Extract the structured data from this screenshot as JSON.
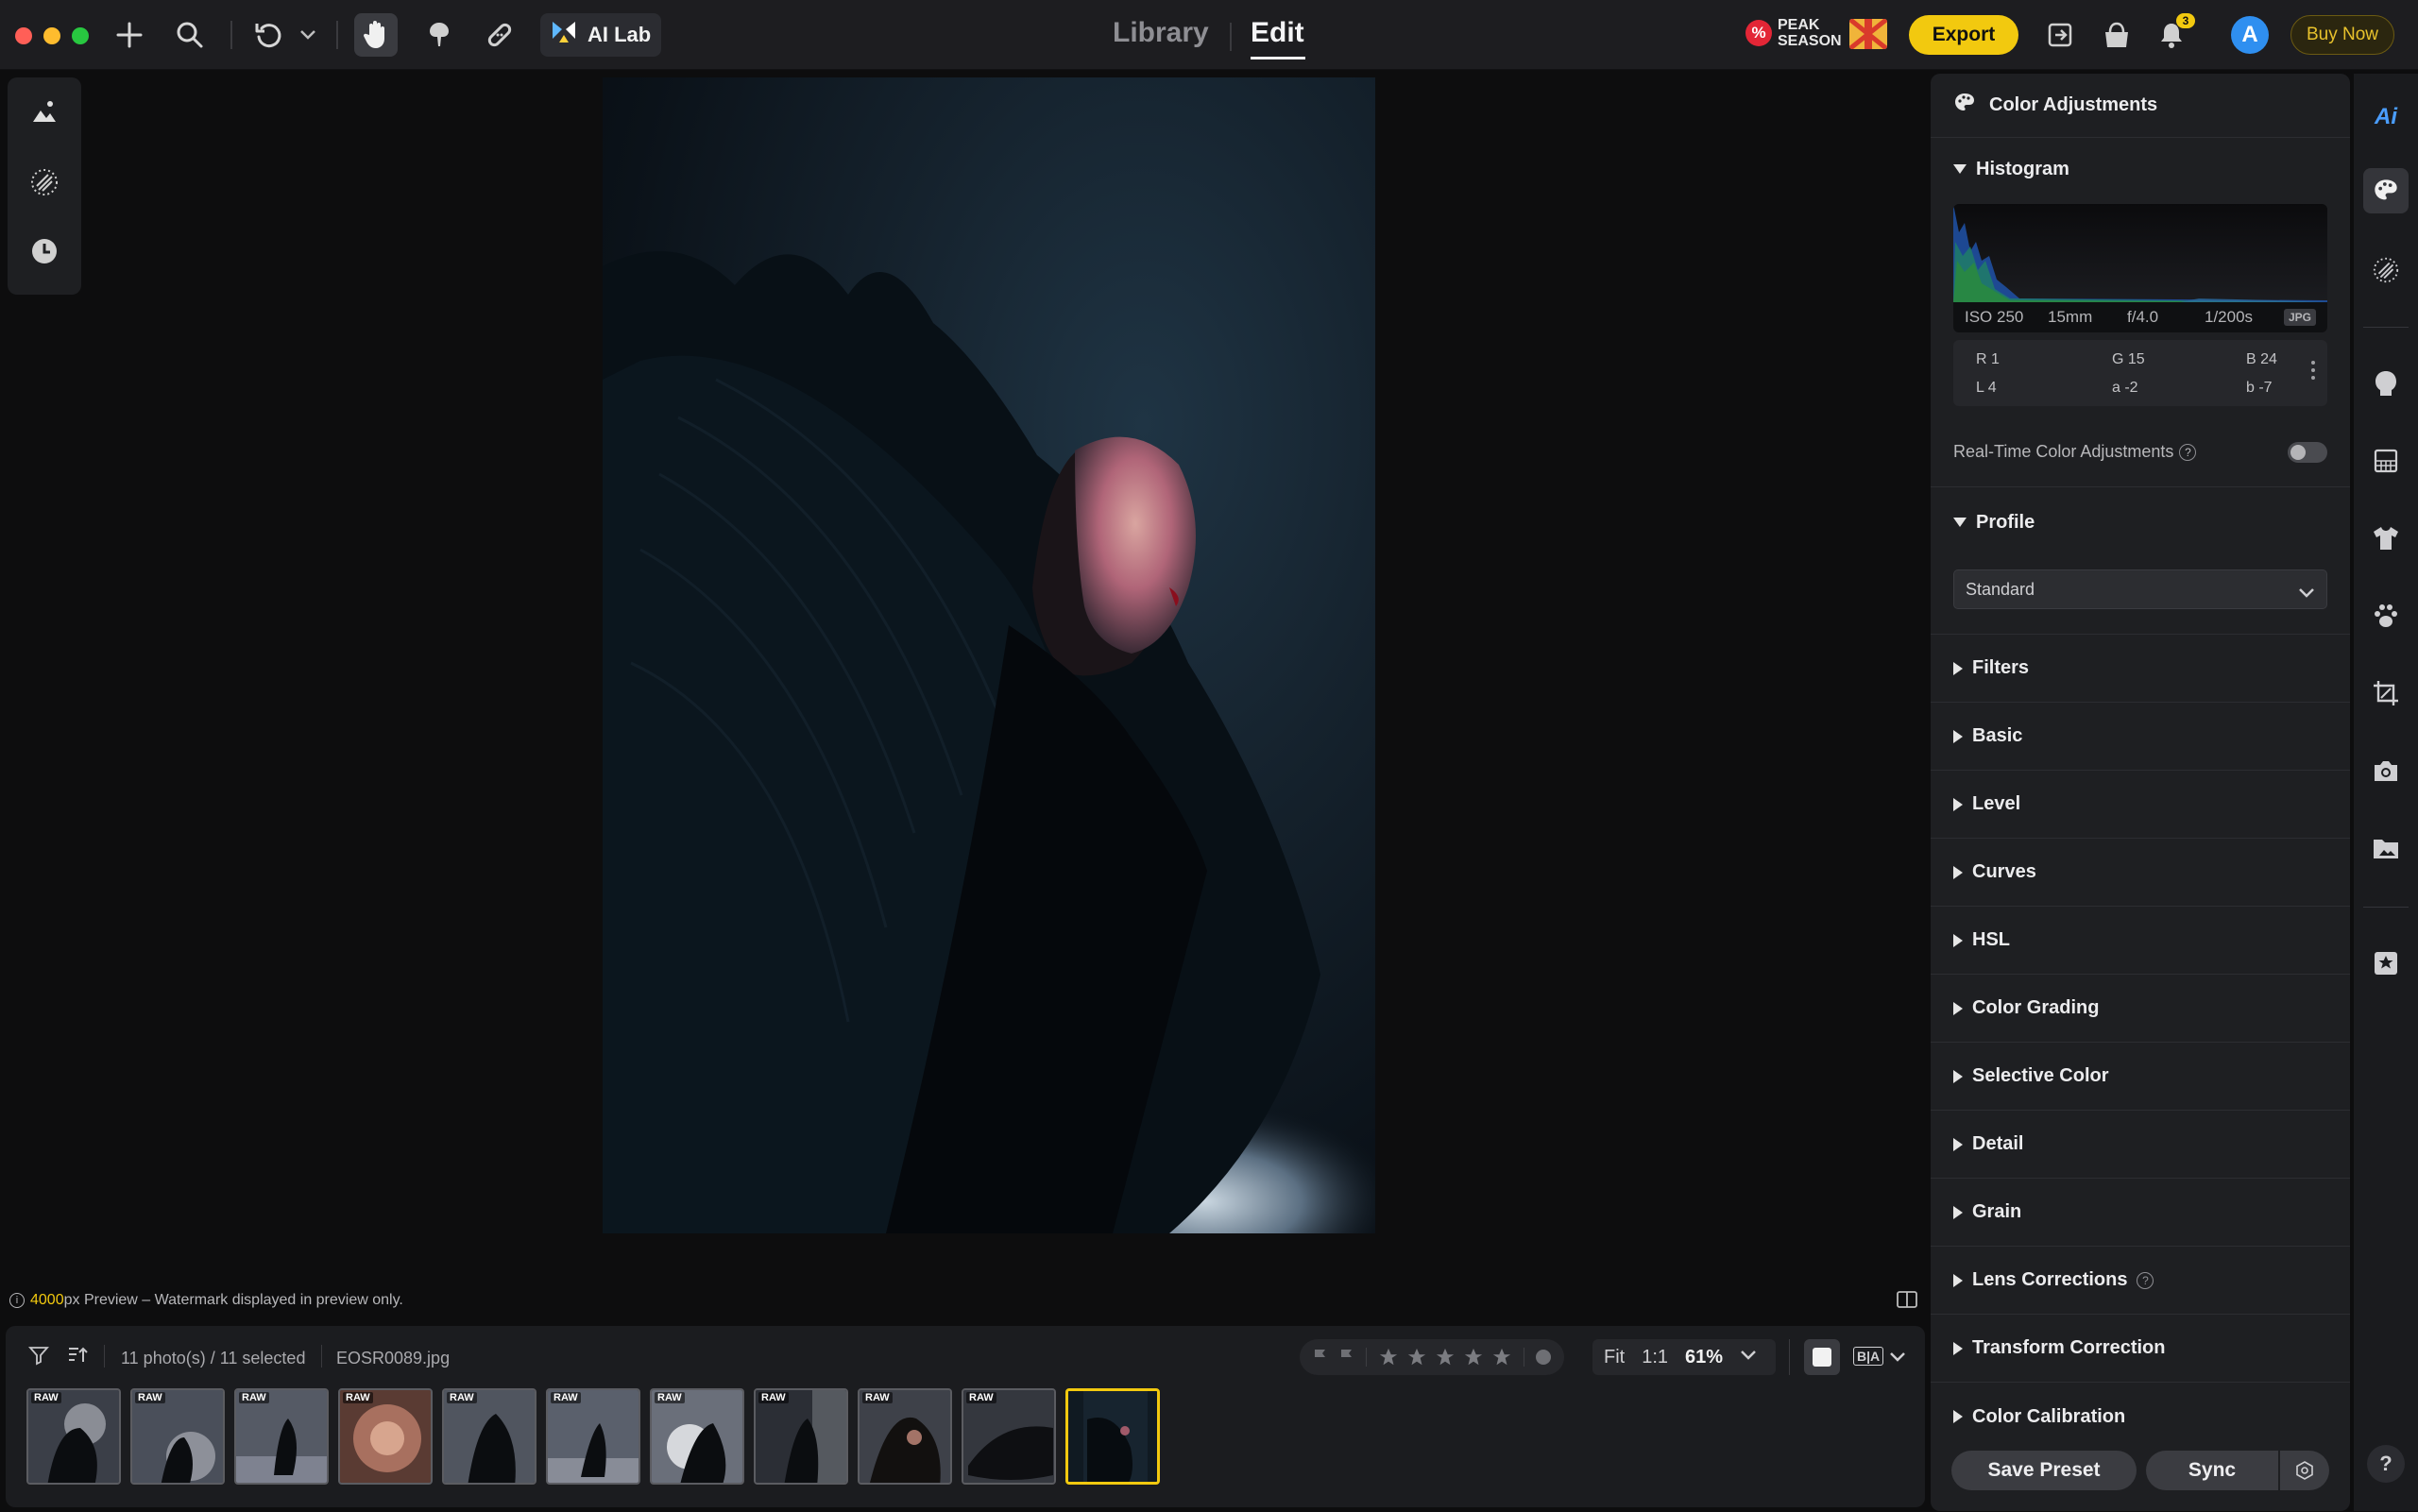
{
  "topbar": {
    "ai_lab_label": "AI Lab",
    "tab_library": "Library",
    "tab_edit": "Edit",
    "promo_line1": "PEAK",
    "promo_line2": "SEASON",
    "export_label": "Export",
    "notification_count": "3",
    "avatar_letter": "A",
    "buy_now_label": "Buy Now",
    "accent": "#f2c90f"
  },
  "canvas": {
    "preview_size": "4000",
    "preview_note": "px Preview – Watermark displayed in preview only."
  },
  "filmstrip": {
    "selection_text": "11 photo(s) / 11 selected",
    "filename": "EOSR0089.jpg",
    "zoom_fit": "Fit",
    "zoom_1to1": "1:1",
    "zoom_level": "61%",
    "compare_label": "B|A",
    "thumb_badge": "RAW",
    "thumbnails": [
      {
        "badge": "RAW"
      },
      {
        "badge": "RAW"
      },
      {
        "badge": "RAW"
      },
      {
        "badge": "RAW"
      },
      {
        "badge": "RAW"
      },
      {
        "badge": "RAW"
      },
      {
        "badge": "RAW"
      },
      {
        "badge": "RAW"
      },
      {
        "badge": "RAW"
      },
      {
        "badge": "RAW"
      },
      {
        "badge": ""
      }
    ]
  },
  "panel": {
    "title": "Color Adjustments",
    "histogram_title": "Histogram",
    "exif": {
      "iso": "ISO 250",
      "focal": "15mm",
      "aperture": "f/4.0",
      "shutter": "1/200s",
      "format": "JPG"
    },
    "color_values": {
      "r": "R 1",
      "g": "G 15",
      "b": "B 24",
      "l": "L 4",
      "a": "a -2",
      "bb": "b -7"
    },
    "realtime_label": "Real-Time Color Adjustments",
    "profile_title": "Profile",
    "profile_value": "Standard",
    "sections": [
      "Filters",
      "Basic",
      "Level",
      "Curves",
      "HSL",
      "Color Grading",
      "Selective Color",
      "Detail",
      "Grain",
      "Lens Corrections",
      "Transform Correction",
      "Color Calibration"
    ],
    "save_preset_label": "Save Preset",
    "sync_label": "Sync"
  },
  "rail": {
    "ai_label": "Ai",
    "help_label": "?"
  }
}
